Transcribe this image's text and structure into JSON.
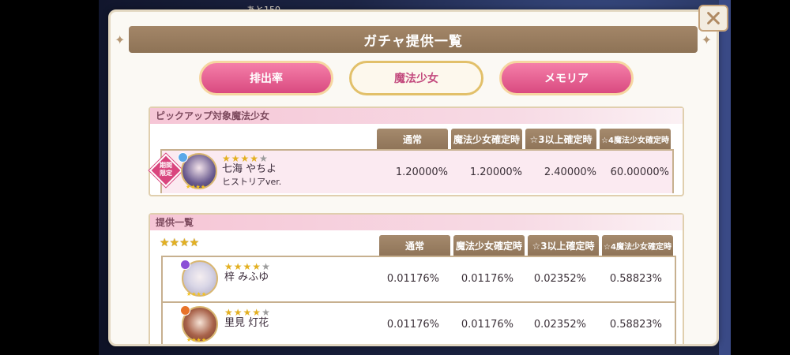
{
  "background": {
    "hint_text": "あと150"
  },
  "header": {
    "title": "ガチャ提供一覧",
    "close_icon": "close-x-icon"
  },
  "tabs": [
    {
      "label": "排出率",
      "active": false
    },
    {
      "label": "魔法少女",
      "active": true
    },
    {
      "label": "メモリア",
      "active": false
    }
  ],
  "pickup": {
    "section_title": "ピックアップ対象魔法少女",
    "columns": [
      "通常",
      "魔法少女確定時",
      "☆3以上確定時",
      "☆4魔法少女確定時"
    ],
    "rows": [
      {
        "badge": [
          "期間",
          "限定"
        ],
        "name": "七海 やちよ",
        "subtitle": "ヒストリアver.",
        "stars_gold": 4,
        "stars_total": 5,
        "attribute_color": "#5aa8e8",
        "rates": [
          "1.20000%",
          "1.20000%",
          "2.40000%",
          "60.00000%"
        ]
      }
    ]
  },
  "listing": {
    "section_title": "提供一覧",
    "rarity_label": "★★★★",
    "columns": [
      "通常",
      "魔法少女確定時",
      "☆3以上確定時",
      "☆4魔法少女確定時"
    ],
    "rows": [
      {
        "name": "梓 みふゆ",
        "stars_gold": 4,
        "stars_total": 5,
        "attribute_color": "#8a4fd6",
        "rates": [
          "0.01176%",
          "0.01176%",
          "0.02352%",
          "0.58823%"
        ]
      },
      {
        "name": "里見 灯花",
        "stars_gold": 4,
        "stars_total": 5,
        "attribute_color": "#e8732a",
        "rates": [
          "0.01176%",
          "0.01176%",
          "0.02352%",
          "0.58823%"
        ]
      }
    ]
  },
  "colors": {
    "tab_inactive": "#e0578a",
    "tab_active_text": "#c34b7e",
    "column_header": "#9a7f62",
    "pickup_row_bg": "#fbeaf1"
  }
}
